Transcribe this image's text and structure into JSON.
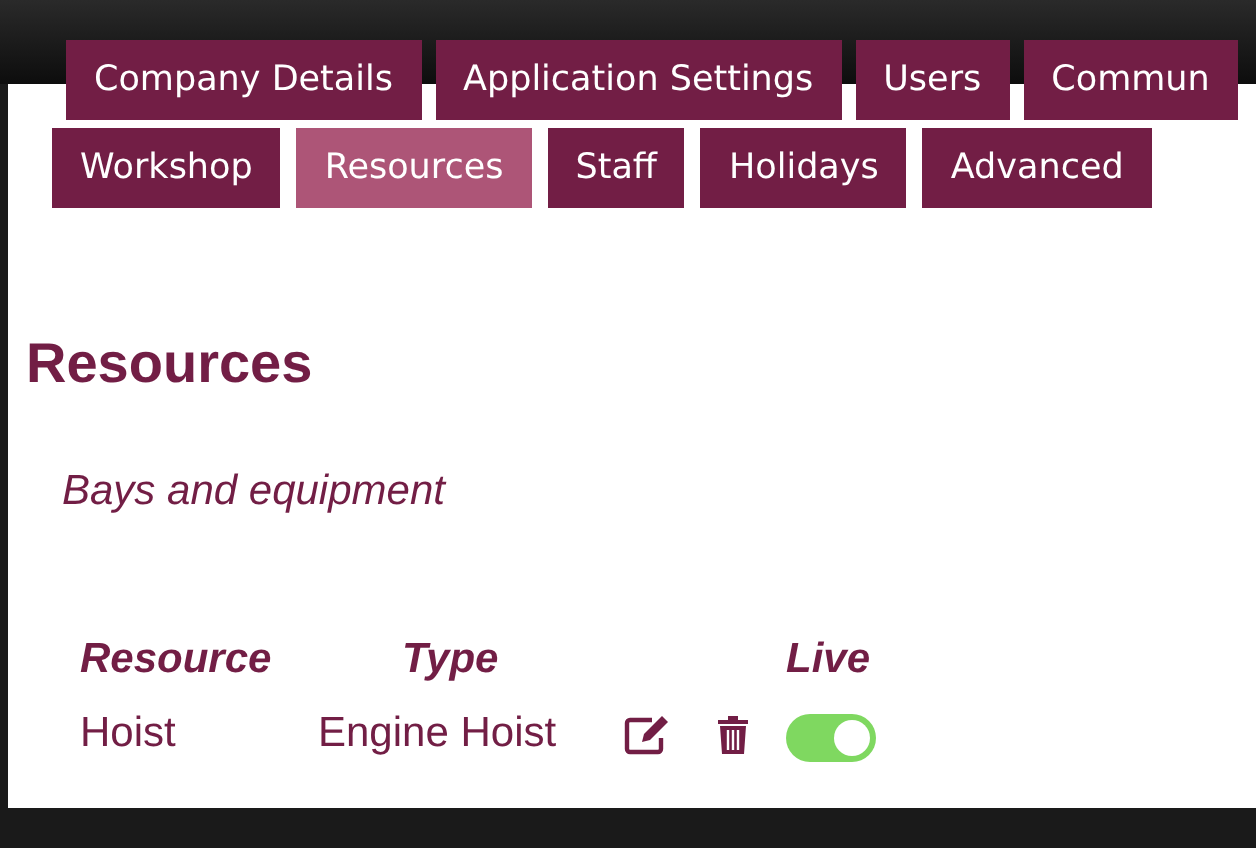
{
  "main_tabs": [
    {
      "label": "Company Details",
      "selected": false
    },
    {
      "label": "Application Settings",
      "selected": false
    },
    {
      "label": "Users",
      "selected": false
    },
    {
      "label": "Commun",
      "selected": false
    }
  ],
  "sub_tabs": [
    {
      "label": "Workshop",
      "selected": false
    },
    {
      "label": "Resources",
      "selected": true
    },
    {
      "label": "Staff",
      "selected": false
    },
    {
      "label": "Holidays",
      "selected": false
    },
    {
      "label": "Advanced",
      "selected": false
    }
  ],
  "heading": "Resources",
  "subtitle": "Bays and equipment",
  "table": {
    "columns": [
      "Resource",
      "Type",
      "Live"
    ],
    "rows": [
      {
        "resource": "Hoist",
        "type": "Engine Hoist",
        "live": true
      }
    ]
  }
}
